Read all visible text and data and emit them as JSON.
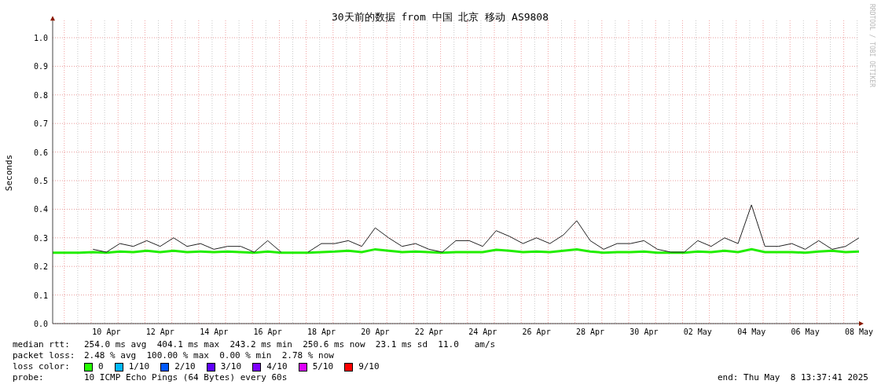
{
  "chart_data": {
    "type": "line",
    "title": "30天前的数据 from 中国 北京 移动 AS9808",
    "ylabel": "Seconds",
    "categories": [
      null,
      null,
      null,
      null,
      "10 Apr",
      null,
      null,
      null,
      "12 Apr",
      null,
      null,
      null,
      "14 Apr",
      null,
      null,
      null,
      "16 Apr",
      null,
      null,
      null,
      "18 Apr",
      null,
      null,
      null,
      "20 Apr",
      null,
      null,
      null,
      "22 Apr",
      null,
      null,
      null,
      "24 Apr",
      null,
      null,
      null,
      "26 Apr",
      null,
      null,
      null,
      "28 Apr",
      null,
      null,
      null,
      "30 Apr",
      null,
      null,
      null,
      "02 May",
      null,
      null,
      null,
      "04 May",
      null,
      null,
      null,
      "06 May",
      null,
      null,
      null,
      "08 May"
    ],
    "ylim": [
      0,
      1.06
    ],
    "grid": true,
    "yticks": [
      {
        "value": 0,
        "label": "0.0"
      },
      {
        "value": 0.1,
        "label": "0.1"
      },
      {
        "value": 0.2,
        "label": "0.2"
      },
      {
        "value": 0.3,
        "label": "0.3"
      },
      {
        "value": 0.4,
        "label": "0.4"
      },
      {
        "value": 0.5,
        "label": "0.5"
      },
      {
        "value": 0.6,
        "label": "0.6"
      },
      {
        "value": 0.7,
        "label": "0.7"
      },
      {
        "value": 0.8,
        "label": "0.8"
      },
      {
        "value": 0.9,
        "label": "0.9"
      },
      {
        "value": 1,
        "label": "1.0"
      }
    ],
    "series": [
      {
        "color": "#202020",
        "values": [
          null,
          null,
          null,
          0.26,
          0.25,
          0.28,
          0.27,
          0.29,
          0.27,
          0.3,
          0.27,
          0.28,
          0.26,
          0.27,
          0.27,
          0.25,
          0.29,
          0.25,
          null,
          0.25,
          0.28,
          0.28,
          0.29,
          0.27,
          0.335,
          0.3,
          0.27,
          0.28,
          0.26,
          0.25,
          0.29,
          0.29,
          0.27,
          0.325,
          0.305,
          0.28,
          0.3,
          0.28,
          0.31,
          0.36,
          0.29,
          0.26,
          0.28,
          0.28,
          0.29,
          0.26,
          0.25,
          0.25,
          0.29,
          0.27,
          0.3,
          0.28,
          0.415,
          0.27,
          0.27,
          0.28,
          0.26,
          0.29,
          0.26,
          0.27,
          0.3
        ]
      },
      {
        "color": "#22ee00",
        "values": [
          0.248,
          0.248,
          0.248,
          0.25,
          0.248,
          0.252,
          0.25,
          0.255,
          0.25,
          0.255,
          0.25,
          0.252,
          0.25,
          0.252,
          0.25,
          0.248,
          0.252,
          0.248,
          0.248,
          0.248,
          0.25,
          0.252,
          0.255,
          0.25,
          0.26,
          0.255,
          0.25,
          0.252,
          0.25,
          0.248,
          0.25,
          0.25,
          0.25,
          0.258,
          0.255,
          0.25,
          0.252,
          0.25,
          0.255,
          0.26,
          0.252,
          0.248,
          0.25,
          0.25,
          0.252,
          0.248,
          0.248,
          0.248,
          0.252,
          0.25,
          0.255,
          0.25,
          0.26,
          0.25,
          0.25,
          0.25,
          0.248,
          0.252,
          0.255,
          0.25,
          0.252
        ]
      }
    ]
  },
  "watermark": "RRDTOOL / TOBI OETIKER",
  "median_rtt": {
    "label": "median rtt:",
    "value": "254.0 ms avg  404.1 ms max  243.2 ms min  250.6 ms now  23.1 ms sd  11.0   am/s"
  },
  "packet_loss": {
    "label": "packet loss:",
    "value": "2.48 % avg  100.00 % max  0.00 % min  2.78 % now"
  },
  "loss_color": {
    "label": "loss color:",
    "items": [
      {
        "label": "0",
        "color": "#26ff00"
      },
      {
        "label": "1/10",
        "color": "#00b8ff"
      },
      {
        "label": "2/10",
        "color": "#0059ff"
      },
      {
        "label": "3/10",
        "color": "#5e00ff"
      },
      {
        "label": "4/10",
        "color": "#7e00ff"
      },
      {
        "label": "5/10",
        "color": "#dd00ff"
      },
      {
        "label": "9/10",
        "color": "#ff0000"
      }
    ]
  },
  "probe": {
    "label": "probe:",
    "value": "10 ICMP Echo Pings (64 Bytes) every 60s"
  },
  "end": "end: Thu May  8 13:37:41 2025"
}
